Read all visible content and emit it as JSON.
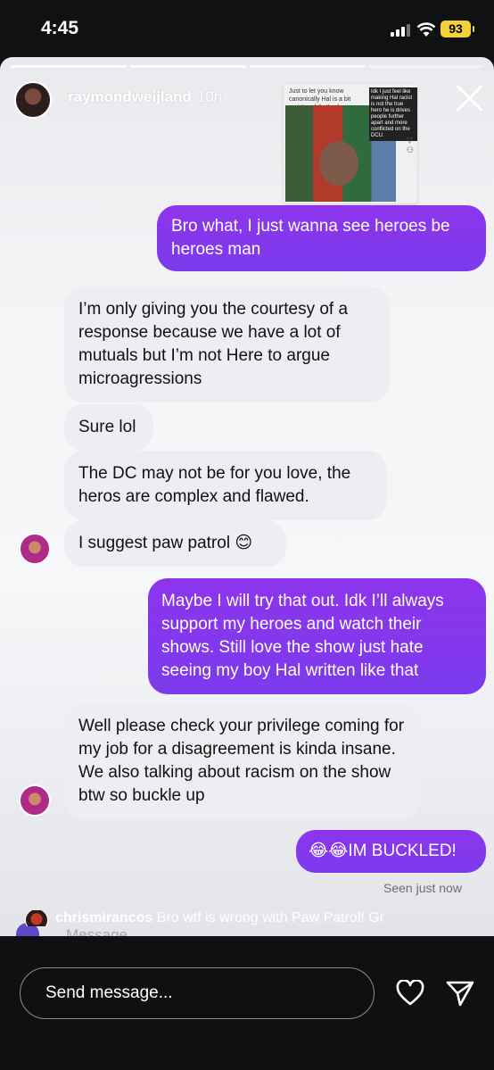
{
  "status_bar": {
    "time": "4:45",
    "battery": "93"
  },
  "story": {
    "username": "raymondweijland",
    "age": "10h",
    "thumbnail": {
      "note": "Just to let you know canonically Hal is a bit racist and that's ok",
      "caption": "Idk I just feel like making Hal racist is not the true hero he is drives people further apart and more conflicted on the DCU."
    }
  },
  "messages": [
    {
      "from": "me",
      "text": "Bro what, I just wanna see heroes be heroes man"
    },
    {
      "from": "them",
      "text": "I’m only giving you the courtesy of a response because we have a lot of mutuals but I’m not Here to argue microagressions"
    },
    {
      "from": "them",
      "text": "Sure lol"
    },
    {
      "from": "them",
      "text": "The DC may not be for you love, the heros are complex and flawed."
    },
    {
      "from": "them",
      "text": "I suggest paw patrol 😊"
    },
    {
      "from": "me",
      "text": "Maybe I will try that out. Idk I’ll always support my heroes and watch their shows. Still love the show just hate seeing my boy Hal written like that"
    },
    {
      "from": "them",
      "text": "Well please check your privilege coming for my job for a disagreement is kinda insane. We also talking about racism on the show btw so buckle up"
    },
    {
      "from": "me",
      "text": "😂😂IM BUCKLED!"
    }
  ],
  "seen": "Seen just now",
  "comment": {
    "user": "chrismirancos",
    "text": "Bro wtf is wrong with Paw Patrol! Gr"
  },
  "ghost_placeholder": "Message...",
  "reply": {
    "placeholder": "Send message..."
  },
  "colors": {
    "accent_purple": "#7c3aed",
    "incoming_bubble": "#eceef1",
    "battery": "#f2d23a"
  }
}
